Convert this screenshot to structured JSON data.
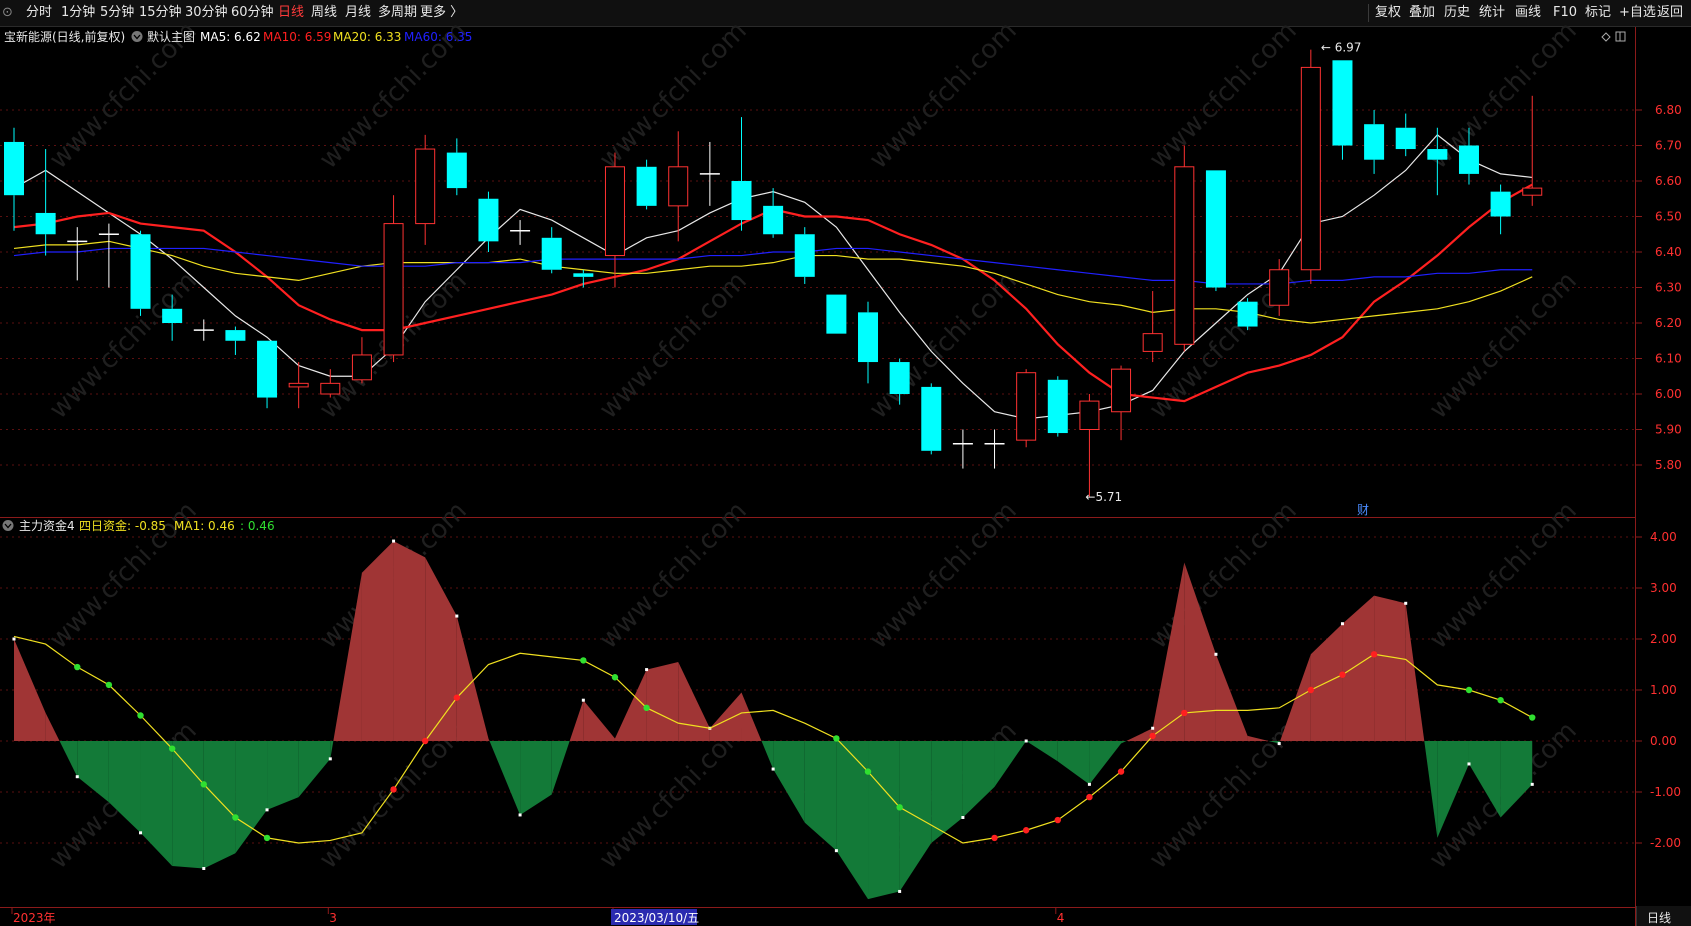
{
  "toolbar": {
    "left_items": [
      "分时",
      "1分钟",
      "5分钟",
      "15分钟",
      "30分钟",
      "60分钟",
      "日线",
      "周线",
      "月线",
      "多周期",
      "更多 〉"
    ],
    "active": "日线",
    "right_items": [
      "复权",
      "叠加",
      "历史",
      "统计",
      "画线",
      "F10",
      "标记",
      "+自选",
      "返回"
    ]
  },
  "main_panel": {
    "stock_title": "宝新能源(日线,前复权)",
    "template_label": "默认主图",
    "ma_labels": [
      {
        "name": "MA5: 6.62",
        "color": "#ffffff"
      },
      {
        "name": "MA10: 6.59",
        "color": "#ff2020"
      },
      {
        "name": "MA20: 6.33",
        "color": "#f0e020"
      },
      {
        "name": "MA60: 6.35",
        "color": "#2020ff"
      }
    ],
    "high_label": "6.97",
    "low_label": "5.71",
    "marker": "财"
  },
  "sub_panel": {
    "title": "主力资金4",
    "labels": [
      {
        "name": "四日资金: -0.85",
        "color": "#f0e020"
      },
      {
        "name": "MA1: 0.46",
        "color": "#f0e020"
      },
      {
        "name": ": 0.46",
        "color": "#30e030"
      }
    ]
  },
  "x_axis": {
    "labels": [
      {
        "text": "2023年",
        "bar": 0,
        "color": "#ff3030"
      },
      {
        "text": "3",
        "bar": 10,
        "color": "#ff3030"
      },
      {
        "text": "2023/03/10/五",
        "bar": 19,
        "color": "#ffffff",
        "highlight": true
      },
      {
        "text": "4",
        "bar": 33,
        "color": "#ff3030"
      }
    ],
    "period_button": "日线"
  },
  "chart_data": [
    {
      "type": "candlestick",
      "ylim": [
        5.7,
        7.0
      ],
      "yticks": [
        5.8,
        5.9,
        6.0,
        6.1,
        6.2,
        6.3,
        6.4,
        6.5,
        6.6,
        6.7,
        6.8
      ],
      "candles": [
        [
          6.71,
          6.56,
          6.75,
          6.46
        ],
        [
          6.51,
          6.45,
          6.69,
          6.39
        ],
        [
          6.43,
          6.43,
          6.47,
          6.32
        ],
        [
          6.45,
          6.45,
          6.48,
          6.3
        ],
        [
          6.45,
          6.24,
          6.46,
          6.22
        ],
        [
          6.24,
          6.2,
          6.28,
          6.15
        ],
        [
          6.18,
          6.18,
          6.21,
          6.15
        ],
        [
          6.18,
          6.15,
          6.19,
          6.11
        ],
        [
          6.15,
          5.99,
          6.15,
          5.96
        ],
        [
          6.02,
          6.03,
          6.09,
          5.96
        ],
        [
          6.0,
          6.03,
          6.07,
          5.99
        ],
        [
          6.04,
          6.11,
          6.16,
          6.03
        ],
        [
          6.11,
          6.48,
          6.56,
          6.09
        ],
        [
          6.48,
          6.69,
          6.73,
          6.42
        ],
        [
          6.68,
          6.58,
          6.72,
          6.56
        ],
        [
          6.55,
          6.43,
          6.57,
          6.4
        ],
        [
          6.46,
          6.46,
          6.49,
          6.42
        ],
        [
          6.44,
          6.35,
          6.47,
          6.34
        ],
        [
          6.34,
          6.33,
          6.35,
          6.3
        ],
        [
          6.39,
          6.64,
          6.68,
          6.3
        ],
        [
          6.64,
          6.53,
          6.66,
          6.52
        ],
        [
          6.53,
          6.64,
          6.74,
          6.43
        ],
        [
          6.62,
          6.62,
          6.71,
          6.53
        ],
        [
          6.6,
          6.49,
          6.78,
          6.46
        ],
        [
          6.53,
          6.45,
          6.58,
          6.44
        ],
        [
          6.45,
          6.33,
          6.47,
          6.31
        ],
        [
          6.28,
          6.17,
          6.28,
          6.17
        ],
        [
          6.23,
          6.09,
          6.26,
          6.03
        ],
        [
          6.09,
          6.0,
          6.1,
          5.97
        ],
        [
          6.02,
          5.84,
          6.03,
          5.83
        ],
        [
          5.86,
          5.86,
          5.9,
          5.79
        ],
        [
          5.86,
          5.86,
          5.9,
          5.79
        ],
        [
          5.87,
          6.06,
          6.07,
          5.85
        ],
        [
          6.04,
          5.89,
          6.05,
          5.88
        ],
        [
          5.9,
          5.98,
          6.0,
          5.71
        ],
        [
          5.95,
          6.07,
          6.08,
          5.87
        ],
        [
          6.12,
          6.17,
          6.29,
          6.09
        ],
        [
          6.14,
          6.64,
          6.7,
          6.12
        ],
        [
          6.63,
          6.3,
          6.63,
          6.29
        ],
        [
          6.26,
          6.19,
          6.27,
          6.18
        ],
        [
          6.25,
          6.35,
          6.38,
          6.22
        ],
        [
          6.35,
          6.92,
          6.97,
          6.31
        ],
        [
          6.94,
          6.7,
          6.94,
          6.66
        ],
        [
          6.76,
          6.66,
          6.8,
          6.62
        ],
        [
          6.75,
          6.69,
          6.79,
          6.67
        ],
        [
          6.69,
          6.66,
          6.75,
          6.56
        ],
        [
          6.7,
          6.62,
          6.75,
          6.59
        ],
        [
          6.57,
          6.5,
          6.59,
          6.45
        ],
        [
          6.56,
          6.58,
          6.84,
          6.53
        ]
      ],
      "series": [
        {
          "name": "MA5",
          "color": "#e8e8e8",
          "values": [
            6.58,
            6.63,
            6.57,
            6.51,
            6.45,
            6.38,
            6.3,
            6.22,
            6.16,
            6.08,
            6.05,
            6.05,
            6.13,
            6.26,
            6.35,
            6.44,
            6.52,
            6.49,
            6.44,
            6.39,
            6.44,
            6.46,
            6.51,
            6.55,
            6.57,
            6.54,
            6.47,
            6.35,
            6.23,
            6.12,
            6.03,
            5.95,
            5.93,
            5.94,
            5.95,
            5.97,
            6.01,
            6.12,
            6.2,
            6.28,
            6.34,
            6.48,
            6.5,
            6.56,
            6.63,
            6.73,
            6.66,
            6.62,
            6.61
          ]
        },
        {
          "name": "MA10",
          "color": "#ff2020",
          "values": [
            6.47,
            6.48,
            6.5,
            6.51,
            6.48,
            6.47,
            6.46,
            6.4,
            6.33,
            6.25,
            6.21,
            6.18,
            6.18,
            6.2,
            6.22,
            6.24,
            6.26,
            6.28,
            6.31,
            6.33,
            6.35,
            6.38,
            6.43,
            6.48,
            6.52,
            6.5,
            6.5,
            6.49,
            6.45,
            6.42,
            6.38,
            6.32,
            6.24,
            6.14,
            6.06,
            6.0,
            5.99,
            5.98,
            6.02,
            6.06,
            6.08,
            6.11,
            6.16,
            6.26,
            6.32,
            6.39,
            6.47,
            6.54,
            6.59
          ]
        },
        {
          "name": "MA20",
          "color": "#f0e020",
          "values": [
            6.41,
            6.42,
            6.42,
            6.43,
            6.41,
            6.39,
            6.36,
            6.34,
            6.33,
            6.32,
            6.34,
            6.36,
            6.37,
            6.37,
            6.37,
            6.37,
            6.38,
            6.36,
            6.35,
            6.34,
            6.34,
            6.35,
            6.36,
            6.36,
            6.37,
            6.39,
            6.39,
            6.38,
            6.38,
            6.37,
            6.36,
            6.34,
            6.31,
            6.28,
            6.26,
            6.25,
            6.23,
            6.24,
            6.24,
            6.23,
            6.21,
            6.2,
            6.21,
            6.22,
            6.23,
            6.24,
            6.26,
            6.29,
            6.33
          ]
        },
        {
          "name": "MA60",
          "color": "#2020ff",
          "values": [
            6.39,
            6.4,
            6.4,
            6.41,
            6.41,
            6.41,
            6.41,
            6.4,
            6.39,
            6.38,
            6.37,
            6.36,
            6.36,
            6.36,
            6.37,
            6.37,
            6.37,
            6.38,
            6.38,
            6.38,
            6.38,
            6.38,
            6.39,
            6.39,
            6.4,
            6.4,
            6.41,
            6.41,
            6.4,
            6.39,
            6.38,
            6.37,
            6.36,
            6.35,
            6.34,
            6.33,
            6.32,
            6.32,
            6.31,
            6.31,
            6.31,
            6.32,
            6.32,
            6.33,
            6.33,
            6.34,
            6.34,
            6.35,
            6.35
          ]
        }
      ]
    },
    {
      "type": "area",
      "ylim": [
        -3.0,
        4.2
      ],
      "yticks": [
        -2.0,
        -1.0,
        0.0,
        1.0,
        2.0,
        3.0,
        4.0
      ],
      "series": [
        {
          "name": "四日资金",
          "pos_color": "#a03535",
          "neg_color": "#137a38",
          "values": [
            2.0,
            0.55,
            -0.7,
            -1.2,
            -1.8,
            -2.45,
            -2.5,
            -2.2,
            -1.35,
            -1.1,
            -0.35,
            3.3,
            3.92,
            3.6,
            2.45,
            0.05,
            -1.45,
            -1.05,
            0.8,
            0.05,
            1.4,
            1.55,
            0.25,
            0.95,
            -0.55,
            -1.6,
            -2.15,
            -3.1,
            -2.95,
            -2.0,
            -1.5,
            -0.9,
            0.0,
            -0.4,
            -0.85,
            -0.05,
            0.25,
            3.5,
            1.7,
            0.1,
            -0.05,
            1.7,
            2.3,
            2.85,
            2.7,
            -1.9,
            -0.45,
            -1.5,
            -0.85
          ]
        },
        {
          "name": "MA1",
          "color": "#f0e020",
          "values": [
            2.05,
            1.9,
            1.45,
            1.1,
            0.5,
            -0.15,
            -0.85,
            -1.5,
            -1.9,
            -2.0,
            -1.95,
            -1.8,
            -0.95,
            0.0,
            0.85,
            1.5,
            1.72,
            1.65,
            1.58,
            1.25,
            0.65,
            0.35,
            0.25,
            0.55,
            0.6,
            0.35,
            0.05,
            -0.6,
            -1.3,
            -1.65,
            -2.0,
            -1.9,
            -1.75,
            -1.55,
            -1.1,
            -0.6,
            0.1,
            0.55,
            0.6,
            0.6,
            0.65,
            1.0,
            1.3,
            1.7,
            1.6,
            1.1,
            1.0,
            0.8,
            0.46
          ]
        }
      ]
    }
  ]
}
